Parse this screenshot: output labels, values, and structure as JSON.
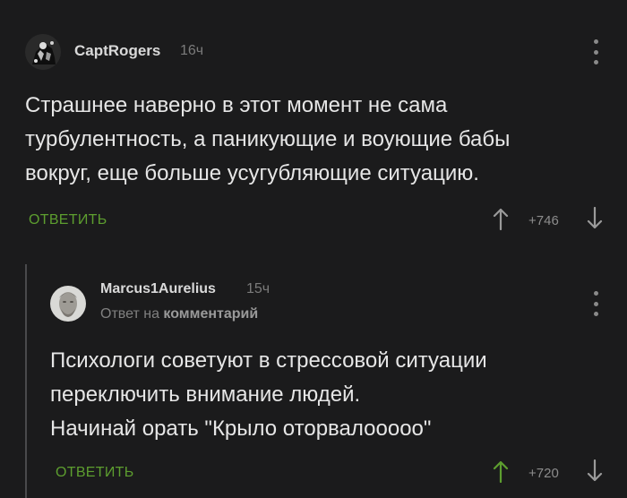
{
  "comments": [
    {
      "author": "CaptRogers",
      "time": "16ч",
      "text_lines": [
        "Страшнее наверно в этот момент не сама",
        "турбулентность, а паникующие и воующие бабы",
        "вокруг, еще больше усугубляющие ситуацию."
      ],
      "reply_label": "ОТВЕТИТЬ",
      "rating": "+746"
    },
    {
      "author": "Marcus1Aurelius",
      "time": "15ч",
      "reply_to_prefix": "Ответ на",
      "reply_to_target": "комментарий",
      "text_lines": [
        "Психологи советуют в стрессовой ситуации",
        "переключить внимание людей.",
        "Начинай орать \"Крыло оторвалооооо\""
      ],
      "reply_label": "ОТВЕТИТЬ",
      "rating": "+720"
    }
  ],
  "colors": {
    "background": "#1b1b1c",
    "accent": "#5d9e2f",
    "text": "#e6e6e6",
    "muted": "#7b7b7b"
  },
  "icons": [
    "avatar",
    "more-vertical-icon",
    "arrow-up-icon",
    "arrow-down-icon"
  ]
}
